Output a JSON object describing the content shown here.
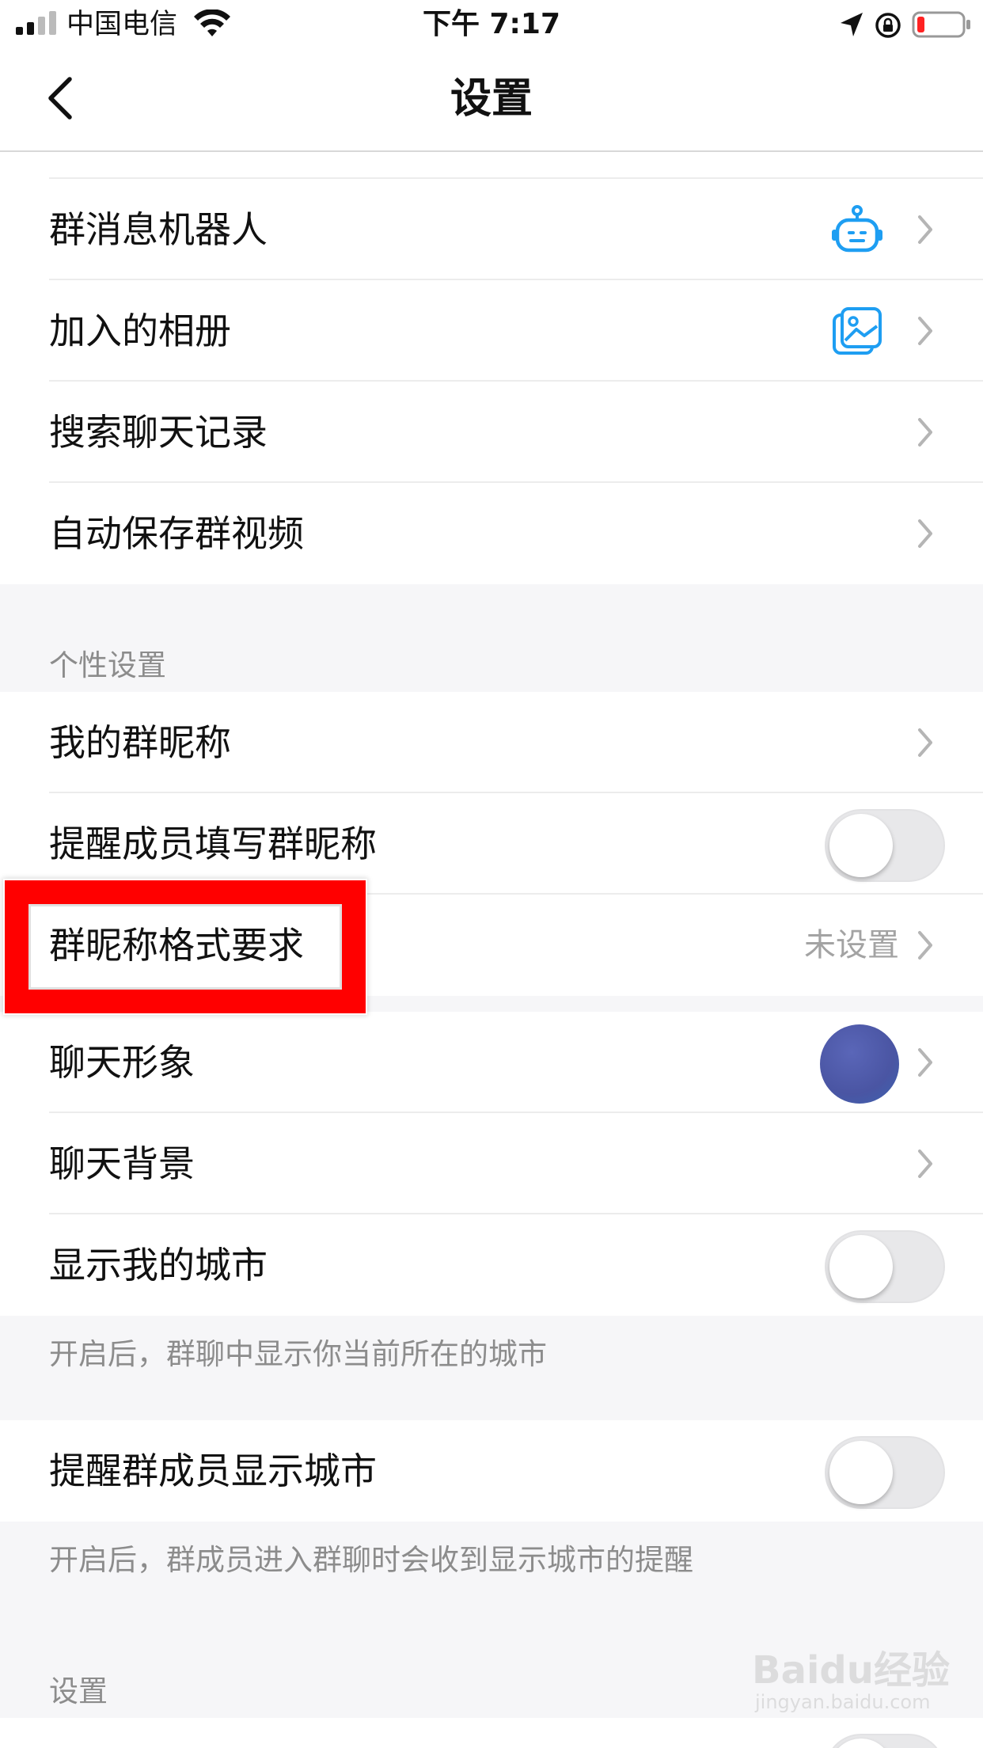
{
  "status_bar": {
    "carrier": "中国电信",
    "time": "下午 7:17"
  },
  "nav": {
    "title": "设置"
  },
  "rows_top": [
    {
      "label": "群消息机器人",
      "icon": "robot-icon"
    },
    {
      "label": "加入的相册",
      "icon": "album-icon"
    },
    {
      "label": "搜索聊天记录"
    },
    {
      "label": "自动保存群视频"
    }
  ],
  "personal_section": {
    "header": "个性设置",
    "my_group_nickname": "我的群昵称",
    "remind_fill_nickname": "提醒成员填写群昵称",
    "nickname_format": "群昵称格式要求",
    "nickname_format_value": "未设置",
    "chat_avatar": "聊天形象",
    "chat_background": "聊天背景",
    "show_my_city": "显示我的城市",
    "show_my_city_note": "开启后，群聊中显示你当前所在的城市",
    "remind_show_city": "提醒群成员显示城市",
    "remind_show_city_note": "开启后，群成员进入群聊时会收到显示城市的提醒"
  },
  "settings_section": {
    "header": "设置"
  },
  "watermark": {
    "main": "Baidu经验",
    "sub": "jingyan.baidu.com"
  },
  "colors": {
    "accent_blue": "#1e9ef2",
    "highlight_red": "#ff0000",
    "toggle_off": "#e8e8ea"
  }
}
